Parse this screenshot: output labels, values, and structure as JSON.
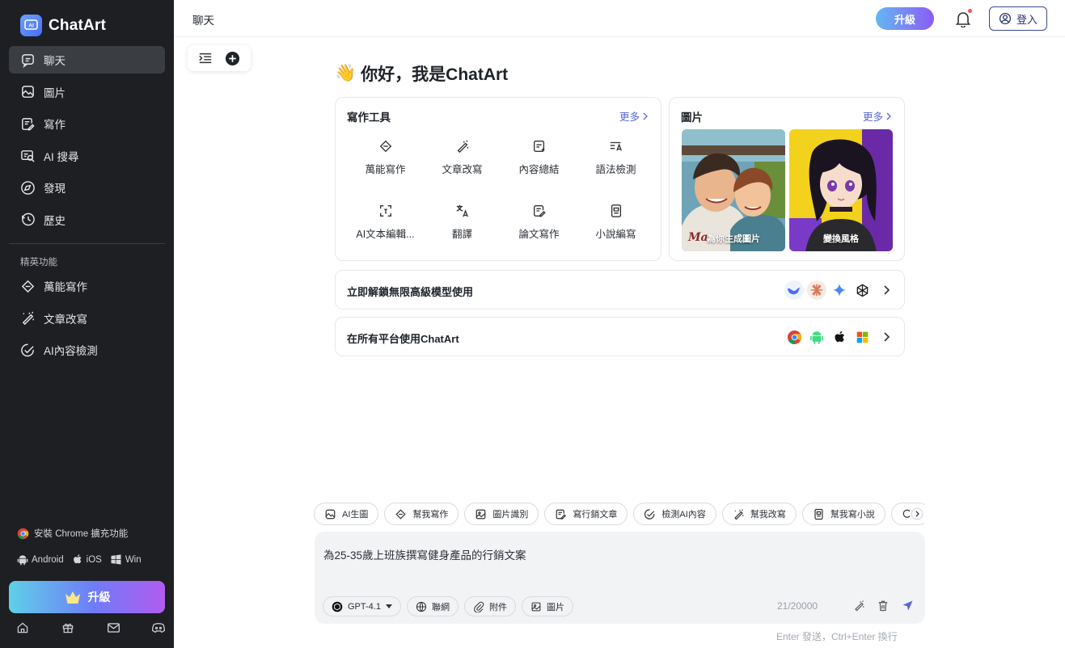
{
  "app": {
    "name": "ChatArt",
    "logo_text": "AI"
  },
  "sidebar": {
    "nav": [
      {
        "label": "聊天",
        "icon": "chat-icon",
        "active": true
      },
      {
        "label": "圖片",
        "icon": "image-icon",
        "active": false
      },
      {
        "label": "寫作",
        "icon": "writing-icon",
        "active": false
      },
      {
        "label": "AI 搜尋",
        "icon": "ai-search-icon",
        "active": false
      },
      {
        "label": "發現",
        "icon": "compass-icon",
        "active": false
      },
      {
        "label": "歷史",
        "icon": "history-icon",
        "active": false
      }
    ],
    "section_title": "精英功能",
    "features": [
      {
        "label": "萬能寫作",
        "icon": "pen-diamond-icon"
      },
      {
        "label": "文章改寫",
        "icon": "magic-wand-icon"
      },
      {
        "label": "AI內容檢測",
        "icon": "check-circle-icon"
      }
    ],
    "install_label": "安裝 Chrome 擴充功能",
    "platforms": [
      {
        "label": "Android",
        "icon": "android-icon"
      },
      {
        "label": "iOS",
        "icon": "apple-icon"
      },
      {
        "label": "Win",
        "icon": "windows-icon"
      }
    ],
    "upgrade_label": "升級",
    "bottom_icons": [
      "home-icon",
      "gift-icon",
      "mail-icon",
      "discord-icon"
    ]
  },
  "header": {
    "title": "聊天",
    "upgrade_label": "升級",
    "login_label": "登入"
  },
  "greeting": {
    "emoji": "👋",
    "text": "你好，我是ChatArt"
  },
  "writing_tools": {
    "title": "寫作工具",
    "more": "更多",
    "items": [
      {
        "label": "萬能寫作",
        "icon": "pen-diamond-icon"
      },
      {
        "label": "文章改寫",
        "icon": "magic-wand-icon"
      },
      {
        "label": "內容總結",
        "icon": "summary-icon"
      },
      {
        "label": "語法檢測",
        "icon": "grammar-icon"
      },
      {
        "label": "AI文本編輯...",
        "icon": "ai-text-edit-icon"
      },
      {
        "label": "翻譯",
        "icon": "translate-icon"
      },
      {
        "label": "論文寫作",
        "icon": "essay-icon"
      },
      {
        "label": "小說編寫",
        "icon": "novel-icon"
      }
    ]
  },
  "images_card": {
    "title": "圖片",
    "more": "更多",
    "tiles": [
      {
        "caption": "為你生成圖片"
      },
      {
        "caption": "變換風格"
      }
    ]
  },
  "promo_rows": [
    {
      "label": "立即解鎖無限高級模型使用",
      "icons": [
        "deepseek-icon",
        "claude-icon",
        "gemini-icon",
        "openai-icon"
      ]
    },
    {
      "label": "在所有平台使用ChatArt",
      "icons": [
        "chrome-icon",
        "android-icon",
        "apple-icon",
        "windows-icon"
      ]
    }
  ],
  "chips": [
    {
      "label": "AI生圖",
      "icon": "image-icon"
    },
    {
      "label": "幫我寫作",
      "icon": "pen-diamond-icon"
    },
    {
      "label": "圖片識別",
      "icon": "image-scan-icon"
    },
    {
      "label": "寫行銷文章",
      "icon": "marketing-icon"
    },
    {
      "label": "檢測AI內容",
      "icon": "check-circle-icon"
    },
    {
      "label": "幫我改寫",
      "icon": "magic-wand-icon"
    },
    {
      "label": "幫我寫小說",
      "icon": "novel-icon"
    },
    {
      "label": "",
      "icon": "search-icon"
    }
  ],
  "composer": {
    "text": "為25-35歲上班族撰寫健身產品的行銷文案",
    "model": "GPT-4.1",
    "tools": [
      {
        "label": "聯網",
        "icon": "globe-icon"
      },
      {
        "label": "附件",
        "icon": "paperclip-icon"
      },
      {
        "label": "圖片",
        "icon": "image-icon"
      }
    ],
    "counter": "21/20000",
    "hint": "Enter 發送，Ctrl+Enter 換行"
  },
  "colors": {
    "sidebar_bg": "#1d1f22",
    "accent": "#5866d6",
    "composer_bg": "#f2f3f5"
  }
}
